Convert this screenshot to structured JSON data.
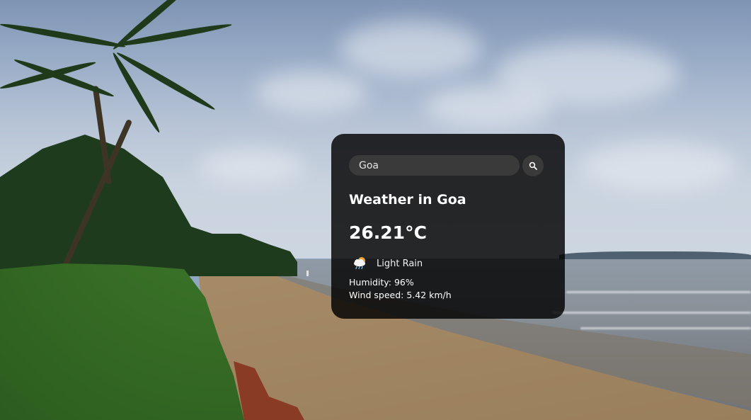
{
  "search": {
    "value": "Goa"
  },
  "weather": {
    "title": "Weather in Goa",
    "temperature": "26.21°C",
    "condition": "Light Rain",
    "condition_icon": "cloud-rain-sun-icon",
    "humidity": "Humidity: 96%",
    "wind_speed": "Wind speed: 5.42 km/h"
  },
  "icons": {
    "search": "search-icon"
  },
  "colors": {
    "card_background": "#000000",
    "text": "#ffffff",
    "input_background": "#3a3a3a"
  }
}
